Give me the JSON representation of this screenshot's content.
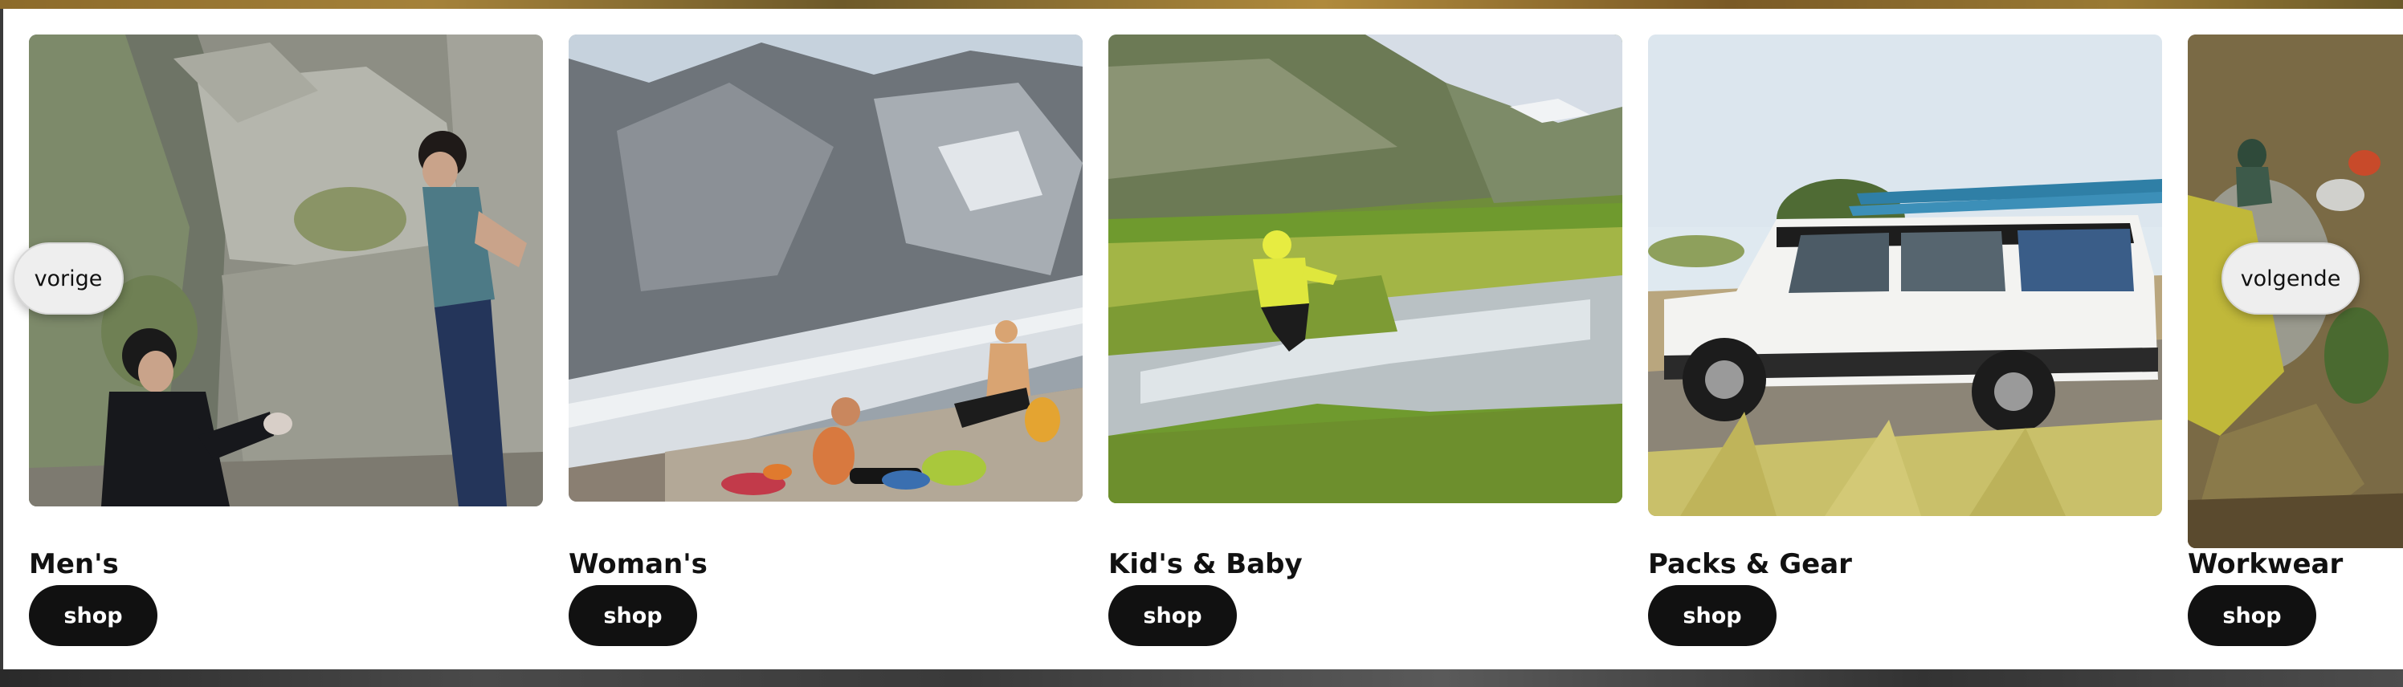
{
  "carousel": {
    "prev_label": "vorige",
    "next_label": "volgende",
    "cards": [
      {
        "title": "Men's",
        "button": "shop",
        "photo": "bouldering-climbers-photo"
      },
      {
        "title": "Woman's",
        "button": "shop",
        "photo": "glacier-mountain-photo"
      },
      {
        "title": "Kid's & Baby",
        "button": "shop",
        "photo": "child-jumping-stream-photo"
      },
      {
        "title": "Packs & Gear",
        "button": "shop",
        "photo": "white-suv-surfboards-photo"
      },
      {
        "title": "Workwear",
        "button": "shop",
        "photo": "workwear-forest-photo"
      }
    ]
  }
}
